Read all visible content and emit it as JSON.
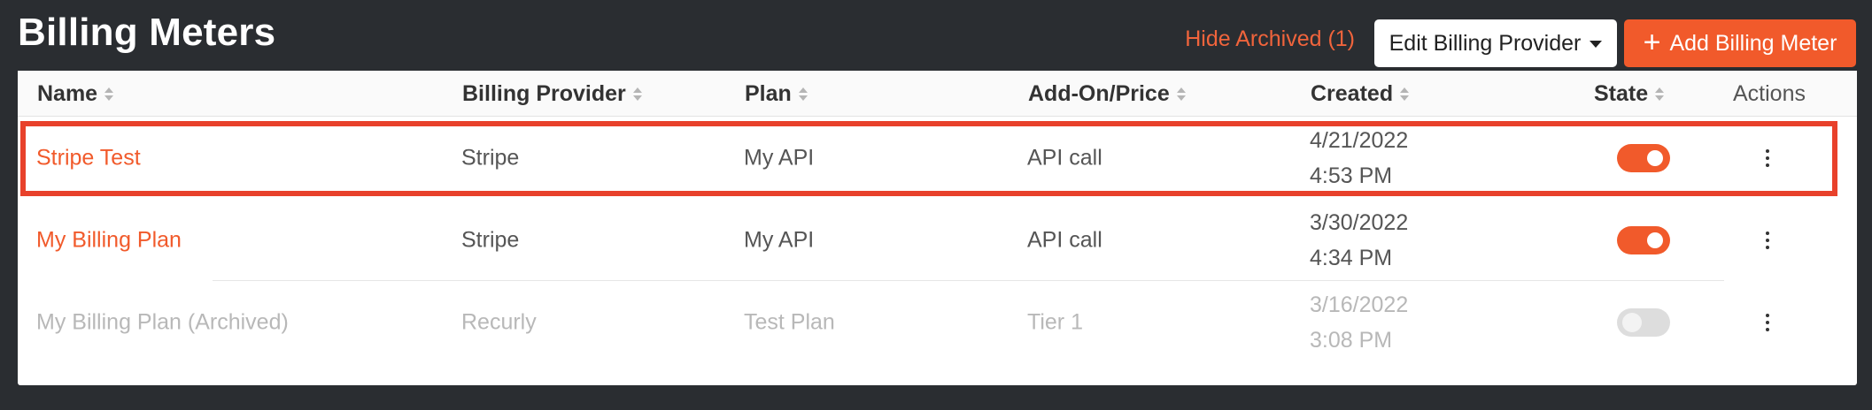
{
  "header": {
    "title": "Billing Meters",
    "hide_archived": "Hide Archived (1)",
    "edit_provider_label": "Edit Billing Provider",
    "add_meter_label": "Add Billing Meter",
    "add_icon": "plus-icon"
  },
  "table": {
    "columns": [
      "Name",
      "Billing Provider",
      "Plan",
      "Add-On/Price",
      "Created",
      "State",
      "Actions"
    ],
    "rows": [
      {
        "name": "Stripe Test",
        "provider": "Stripe",
        "plan": "My API",
        "addon": "API call",
        "created_date": "4/21/2022",
        "created_time": "4:53 PM",
        "state_on": true,
        "archived": false,
        "highlighted": true
      },
      {
        "name": "My Billing Plan",
        "provider": "Stripe",
        "plan": "My API",
        "addon": "API call",
        "created_date": "3/30/2022",
        "created_time": "4:34 PM",
        "state_on": true,
        "archived": false,
        "highlighted": false
      },
      {
        "name": "My Billing Plan (Archived)",
        "provider": "Recurly",
        "plan": "Test Plan",
        "addon": "Tier 1",
        "created_date": "3/16/2022",
        "created_time": "3:08 PM",
        "state_on": false,
        "archived": true,
        "highlighted": false
      }
    ]
  },
  "colors": {
    "accent": "#f15a2b",
    "highlight_border": "#e8412b",
    "background": "#2a2d31"
  }
}
